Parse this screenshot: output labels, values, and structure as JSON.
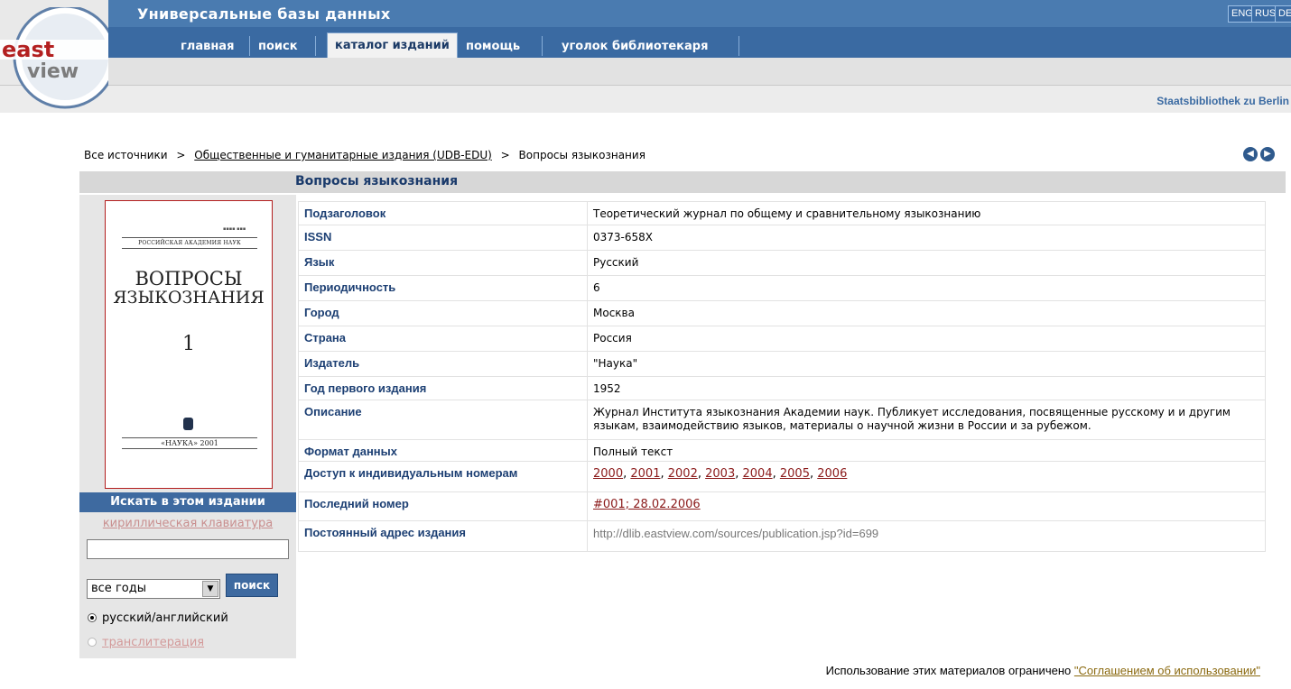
{
  "header": {
    "site_title": "Универсальные базы данных",
    "languages": [
      "ENG",
      "RUS",
      "DE"
    ],
    "institution": "Staatsbibliothek zu Berlin"
  },
  "logo": {
    "line1": "east",
    "line2": "view"
  },
  "nav": {
    "items": [
      {
        "label": "главная",
        "active": false
      },
      {
        "label": "поиск",
        "active": false
      },
      {
        "label": "каталог изданий",
        "active": true
      },
      {
        "label": "помощь",
        "active": false
      },
      {
        "label": "уголок библиотекаря",
        "active": false
      }
    ]
  },
  "breadcrumb": {
    "root": "Все источники",
    "sep": ">",
    "collection": "Общественные и гуманитарные издания (UDB-EDU)",
    "current": "Вопросы языкознания"
  },
  "publication": {
    "title": "Вопросы языкознания",
    "rows": [
      {
        "label": "Подзаголовок",
        "value": "Теоретический журнал по общему и сравнительному языкознанию"
      },
      {
        "label": "ISSN",
        "value": "0373-658X"
      },
      {
        "label": "Язык",
        "value": "Русский"
      },
      {
        "label": "Периодичность",
        "value": "6"
      },
      {
        "label": "Город",
        "value": "Москва"
      },
      {
        "label": "Страна",
        "value": "Россия"
      },
      {
        "label": "Издатель",
        "value": "\"Наука\""
      },
      {
        "label": "Год первого издания",
        "value": "1952"
      },
      {
        "label": "Описание",
        "value": "Журнал Института языкознания Академии наук. Публикует исследования, посвященные русскому и и другим языкам, взаимодействию языков, материалы о научной жизни в России и за рубежом."
      },
      {
        "label": "Формат данных",
        "value": "Полный текст"
      }
    ],
    "access_label": "Доступ к индивидуальным номерам",
    "years": [
      "2000",
      "2001",
      "2002",
      "2003",
      "2004",
      "2005",
      "2006"
    ],
    "year_sep": ",",
    "last_issue_label": "Последний номер",
    "last_issue_value": "#001; 28.02.2006",
    "permalink_label": "Постоянный адрес издания",
    "permalink_value": "http://dlib.eastview.com/sources/publication.jsp?id=699"
  },
  "cover": {
    "academy": "РОССИЙСКАЯ АКАДЕМИЯ НАУК",
    "title_line1": "ВОПРОСЫ",
    "title_line2": "ЯЗЫКОЗНАНИЯ",
    "issue": "1",
    "footer": "«НАУКА» 2001"
  },
  "search": {
    "heading": "Искать в этом издании",
    "keyboard_link": "кириллическая клавиатура",
    "query_value": "",
    "year_selected": "все годы",
    "button": "поиск",
    "radio_ru_en": "русский/английский",
    "radio_translit": "транслитерация"
  },
  "footer": {
    "text": "Использование этих материалов ограничено",
    "link": "\"Соглашением об использовании\""
  }
}
